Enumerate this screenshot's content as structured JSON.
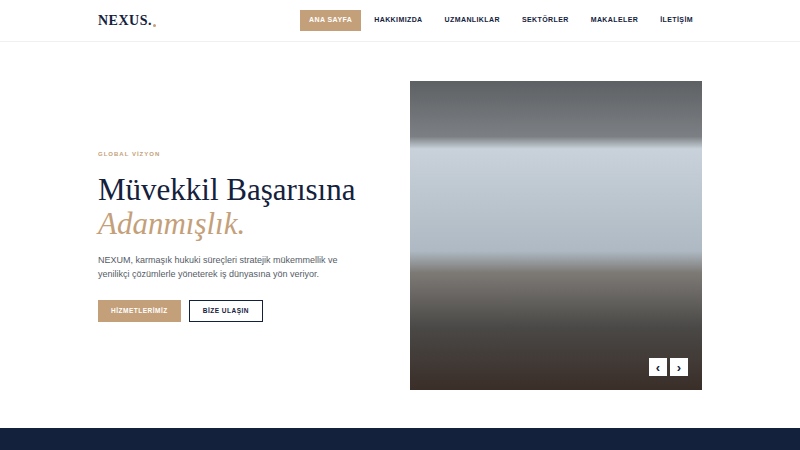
{
  "logo": "NEXUS.",
  "nav": [
    {
      "label": "ANA SAYFA",
      "selected": true
    },
    {
      "label": "HAKKIMIZDA",
      "selected": false
    },
    {
      "label": "UZMANLIKLAR",
      "selected": false
    },
    {
      "label": "SEKTÖRLER",
      "selected": false
    },
    {
      "label": "MAKALELER",
      "selected": false
    },
    {
      "label": "İLETİŞİM",
      "selected": false
    }
  ],
  "hero": {
    "eyebrow": "GLOBAL VİZYON",
    "title": "Müvekkil Başarısına",
    "title_accent": "Adanmışlık.",
    "text": "NEXUM, karmaşık hukuki süreçleri stratejik mükemmellik ve yenilikçi çözümlerle yöneterek iş dünyasına yön veriyor.",
    "buttons": [
      {
        "label": "HİZMETLERİMİZ",
        "kind": "primary"
      },
      {
        "label": "BİZE ULAŞIN",
        "kind": "outline"
      }
    ]
  },
  "carousel": {
    "prev": "‹",
    "next": "›"
  }
}
